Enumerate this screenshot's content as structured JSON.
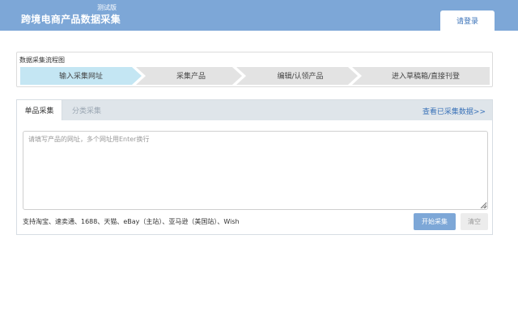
{
  "header": {
    "badge": "测试版",
    "title": "跨境电商产品数据采集",
    "login_label": "请登录"
  },
  "flow": {
    "title": "数据采集流程图",
    "steps": [
      {
        "label": "输入采集网址",
        "active": true
      },
      {
        "label": "采集产品",
        "active": false
      },
      {
        "label": "编辑/认领产品",
        "active": false
      },
      {
        "label": "进入草稿箱/直接刊登",
        "active": false
      }
    ],
    "colors": {
      "active": "#c4e6f3",
      "inactive": "#e3e3e3"
    }
  },
  "panel": {
    "tabs": [
      {
        "label": "单品采集",
        "active": true
      },
      {
        "label": "分类采集",
        "active": false
      }
    ],
    "view_link": "查看已采集数据>>",
    "url_input": {
      "value": "",
      "placeholder": "请填写产品的网址，多个网址用Enter换行"
    },
    "support_text": "支持淘宝、速卖通、1688、天猫、eBay（主站）、亚马逊（美国站）、Wish",
    "start_label": "开始采集",
    "clear_label": "清空"
  },
  "colors": {
    "brand": "#7da7d7",
    "link": "#3a72b8"
  }
}
